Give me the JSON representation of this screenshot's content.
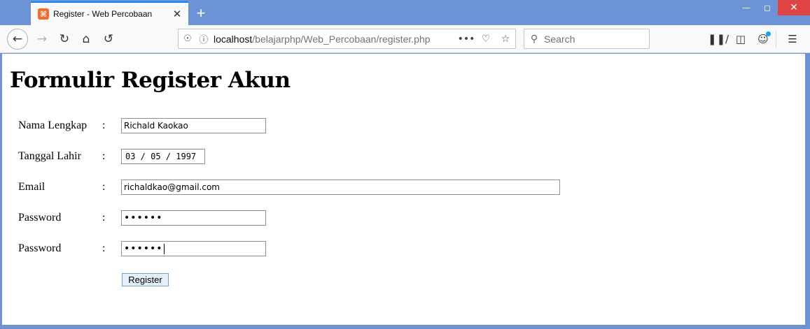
{
  "browser": {
    "tab_title": "Register - Web Percobaan",
    "tab_favicon": "xampp-icon",
    "url_host": "localhost",
    "url_path": "/belajarphp/Web_Percobaan/register.php",
    "search_placeholder": "Search",
    "new_tab_symbol": "+",
    "tab_close_symbol": "✕"
  },
  "page": {
    "heading": "Formulir Register Akun",
    "colon": ":",
    "fields": [
      {
        "label": "Nama Lengkap",
        "value": "Richald Kaokao"
      },
      {
        "label": "Tanggal Lahir",
        "value": "03 / 05 / 1997"
      },
      {
        "label": "Email",
        "value": "richaldkao@gmail.com"
      },
      {
        "label": "Password",
        "value": "••••••"
      },
      {
        "label": "Password",
        "value": "••••••"
      }
    ],
    "submit_label": "Register"
  },
  "colors": {
    "frame": "#6b93d6",
    "tab_accent": "#0a84ff",
    "close_button": "#e04343",
    "submit_bg": "#e8f1fb",
    "submit_border": "#6ea2d8"
  }
}
